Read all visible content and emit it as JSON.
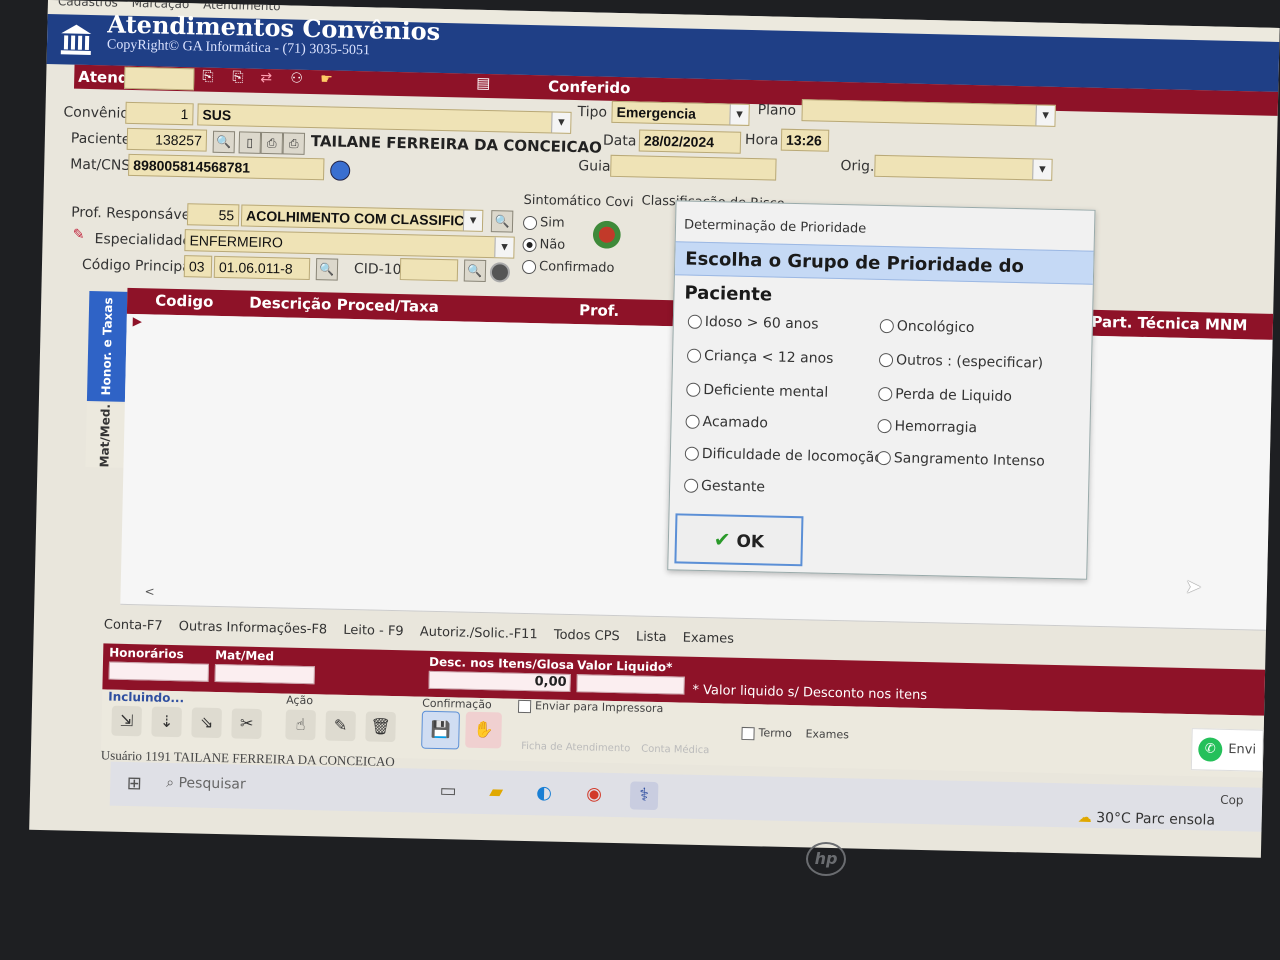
{
  "menu": {
    "items": [
      "Cadastros",
      "Marcação",
      "Atendimento"
    ]
  },
  "app": {
    "title": "Atendimentos Convênios",
    "subtitle": "CopyRight© GA Informática - (71) 3035-5051"
  },
  "header": {
    "atend_label": "Atend.",
    "conferido_label": "Conferido"
  },
  "form": {
    "convenio_label": "Convênio",
    "convenio_code": "1",
    "convenio_name": "SUS",
    "tipo_label": "Tipo",
    "tipo_value": "Emergencia",
    "plano_label": "Plano",
    "paciente_label": "Paciente",
    "paciente_code": "138257",
    "paciente_name": "TAILANE FERREIRA DA CONCEICAO",
    "data_label": "Data",
    "data_value": "28/02/2024",
    "hora_label": "Hora",
    "hora_value": "13:26",
    "matcns_label": "Mat/CNS",
    "matcns_value": "898005814568781",
    "guia_label": "Guia",
    "orig_label": "Orig.",
    "prof_label": "Prof. Responsável",
    "prof_code": "55",
    "prof_name": "ACOLHIMENTO COM CLASSIFIC",
    "especialidade_label": "Especialidade",
    "especialidade_value": "ENFERMEIRO",
    "codigo_label": "Código Principal",
    "codigo_a": "03",
    "codigo_b": "01.06.011-8",
    "cid_label": "CID-10",
    "sintomatico_label": "Sintomático Covi",
    "sim_label": "Sim",
    "nao_label": "Não",
    "confirmado_label": "Confirmado",
    "classificacao_label": "Classificação de Risco"
  },
  "side_tabs": {
    "honor": "Honor. e Taxas",
    "matmed": "Mat/Med."
  },
  "grid": {
    "col_codigo": "Codigo",
    "col_desc": "Descrição Proced/Taxa",
    "col_prof": "Prof.",
    "col_gr": "Gr. Part. Técnica MNM"
  },
  "bottom_tabs": [
    "Conta-F7",
    "Outras Informações-F8",
    "Leito - F9",
    "Autoriz./Solic.-F11",
    "Todos CPS",
    "Lista",
    "Exames"
  ],
  "totals": {
    "honorarios_label": "Honorários",
    "matmed_label": "Mat/Med",
    "desc_label": "Desc. nos Itens/Glosa",
    "desc_value": "0,00",
    "liquido_label": "Valor Liquido*",
    "note": "* Valor liquido s/ Desconto nos itens"
  },
  "actions": {
    "incluindo": "Incluindo...",
    "acao": "Ação",
    "confirmacao": "Confirmação",
    "enviar_impressora": "Enviar para Impressora",
    "ficha": "Ficha de Atendimento",
    "conta_medica": "Conta Médica",
    "termo": "Termo",
    "exames": "Exames",
    "whatsapp": "Envi",
    "cop": "Cop"
  },
  "status": {
    "usuario": "Usuário 1191 TAILANE FERREIRA DA CONCEICAO"
  },
  "taskbar": {
    "search_placeholder": "Pesquisar",
    "temperature": "30°C",
    "weather": "Parc ensola"
  },
  "dialog": {
    "window_title": "Determinação de Prioridade",
    "heading": "Escolha o Grupo de Prioridade do Paciente",
    "left_options": [
      "Idoso > 60 anos",
      "Criança < 12 anos",
      "Deficiente mental",
      "Acamado",
      "Dificuldade de locomoção",
      "Gestante"
    ],
    "right_options": [
      "Oncológico",
      "Outros : (especificar)",
      "Perda de Liquido",
      "Hemorragia",
      "Sangramento Intenso"
    ],
    "ok_label": "OK"
  },
  "monitor": {
    "brand": "hp"
  }
}
